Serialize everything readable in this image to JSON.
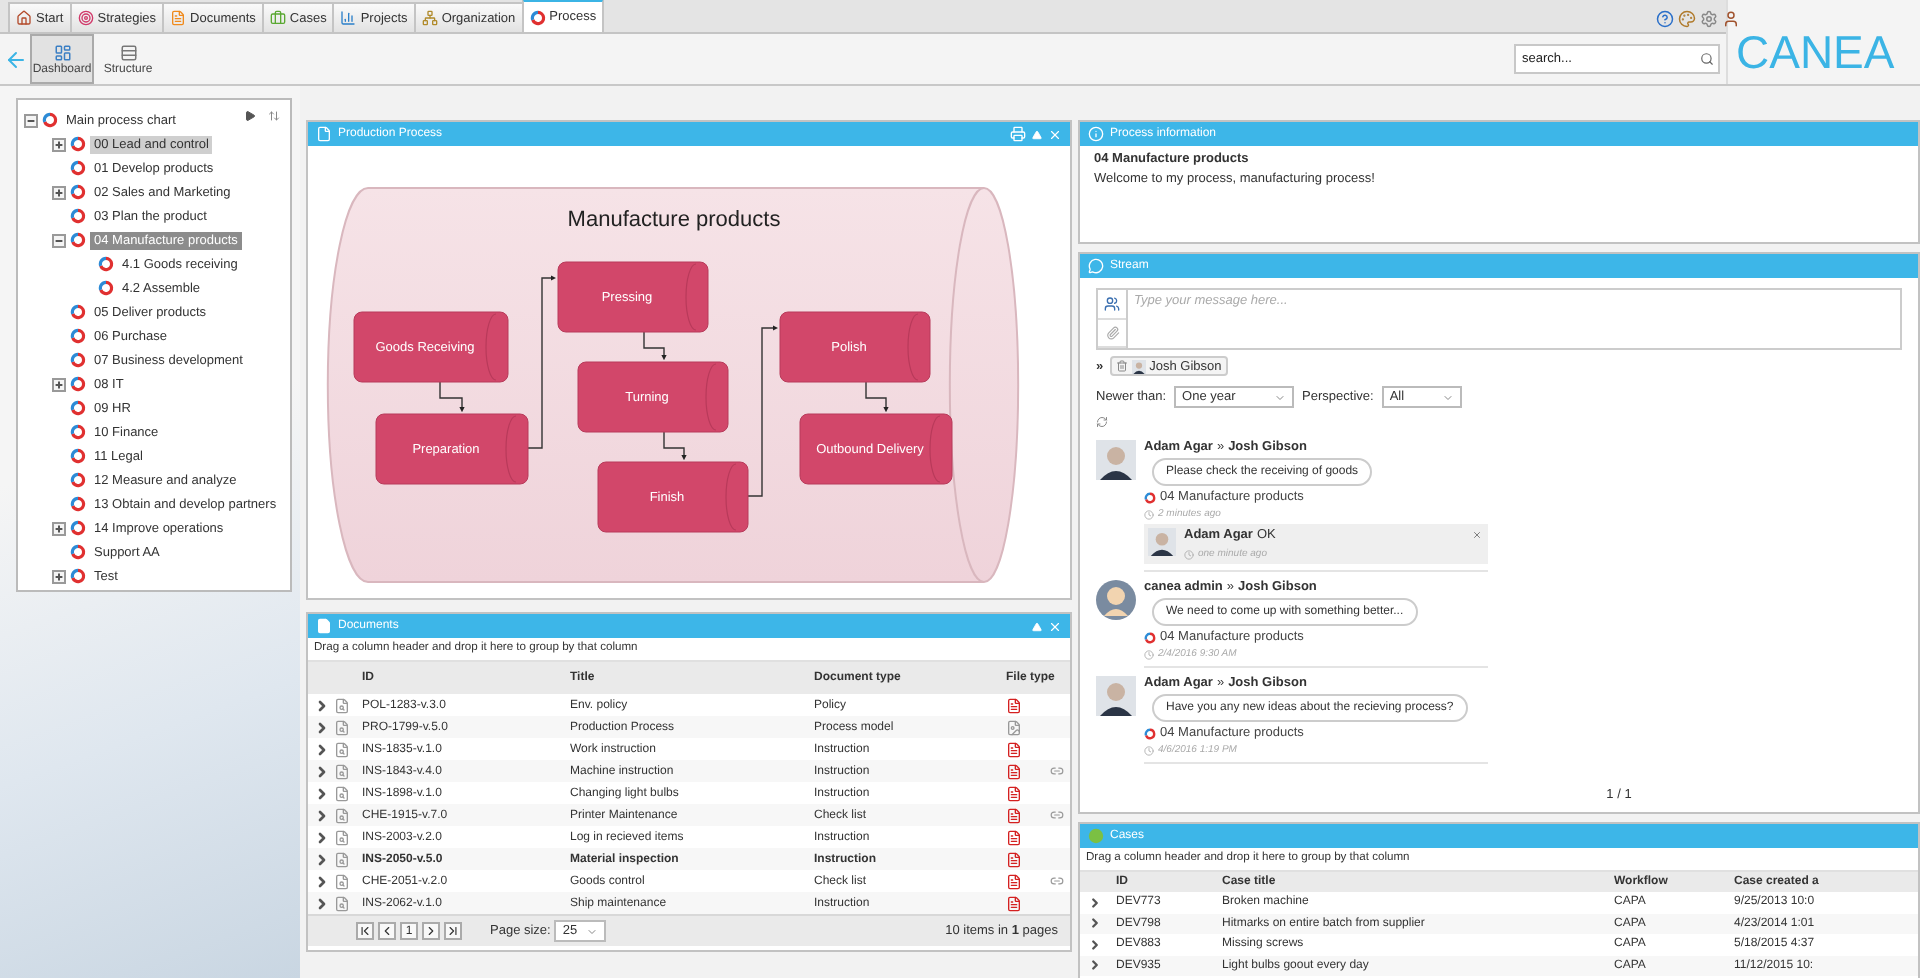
{
  "top_tabs": [
    {
      "label": "Start",
      "selected": false
    },
    {
      "label": "Strategies",
      "selected": false
    },
    {
      "label": "Documents",
      "selected": false
    },
    {
      "label": "Cases",
      "selected": false
    },
    {
      "label": "Projects",
      "selected": false
    },
    {
      "label": "Organization",
      "selected": false
    },
    {
      "label": "Process",
      "selected": true
    }
  ],
  "view_buttons": [
    {
      "label": "Dashboard",
      "selected": true
    },
    {
      "label": "Structure",
      "selected": false
    }
  ],
  "search": {
    "placeholder": "search..."
  },
  "logo": "CANEA",
  "tree": {
    "label": "Main process chart",
    "expandable": true,
    "expanded": true,
    "selected": false,
    "hovered": false,
    "children": [
      {
        "label": "00 Lead and control",
        "expandable": true,
        "expanded": false,
        "selected": false,
        "hovered": true
      },
      {
        "label": "01 Develop products",
        "expandable": false,
        "expanded": false,
        "selected": false,
        "hovered": false
      },
      {
        "label": "02 Sales and Marketing",
        "expandable": true,
        "expanded": false,
        "selected": false,
        "hovered": false
      },
      {
        "label": "03 Plan the product",
        "expandable": false,
        "expanded": false,
        "selected": false,
        "hovered": false
      },
      {
        "label": "04 Manufacture products",
        "expandable": true,
        "expanded": true,
        "selected": true,
        "hovered": false,
        "children": [
          {
            "label": "4.1 Goods receiving",
            "expandable": false,
            "expanded": false,
            "selected": false,
            "hovered": false
          },
          {
            "label": "4.2 Assemble",
            "expandable": false,
            "expanded": false,
            "selected": false,
            "hovered": false
          }
        ]
      },
      {
        "label": "05 Deliver products",
        "expandable": false,
        "expanded": false,
        "selected": false,
        "hovered": false
      },
      {
        "label": "06 Purchase",
        "expandable": false,
        "expanded": false,
        "selected": false,
        "hovered": false
      },
      {
        "label": "07 Business development",
        "expandable": false,
        "expanded": false,
        "selected": false,
        "hovered": false
      },
      {
        "label": "08 IT",
        "expandable": true,
        "expanded": false,
        "selected": false,
        "hovered": false
      },
      {
        "label": "09 HR",
        "expandable": false,
        "expanded": false,
        "selected": false,
        "hovered": false
      },
      {
        "label": "10 Finance",
        "expandable": false,
        "expanded": false,
        "selected": false,
        "hovered": false
      },
      {
        "label": "11 Legal",
        "expandable": false,
        "expanded": false,
        "selected": false,
        "hovered": false
      },
      {
        "label": "12 Measure and analyze",
        "expandable": false,
        "expanded": false,
        "selected": false,
        "hovered": false
      },
      {
        "label": "13 Obtain and develop partners",
        "expandable": false,
        "expanded": false,
        "selected": false,
        "hovered": false
      },
      {
        "label": "14 Improve operations",
        "expandable": true,
        "expanded": false,
        "selected": false,
        "hovered": false
      },
      {
        "label": "Support AA",
        "expandable": false,
        "expanded": false,
        "selected": false,
        "hovered": false
      },
      {
        "label": "Test",
        "expandable": true,
        "expanded": false,
        "selected": false,
        "hovered": false
      }
    ]
  },
  "process_panel": {
    "title": "Production Process",
    "diagram_title": "Manufacture products",
    "nodes": [
      {
        "label": "Goods Receiving"
      },
      {
        "label": "Preparation"
      },
      {
        "label": "Pressing"
      },
      {
        "label": "Turning"
      },
      {
        "label": "Finish"
      },
      {
        "label": "Polish"
      },
      {
        "label": "Outbound Delivery"
      }
    ]
  },
  "documents": {
    "title": "Documents",
    "group_hint": "Drag a column header and drop it here to group by that column",
    "columns": [
      "ID",
      "Title",
      "Document type",
      "File type"
    ],
    "rows": [
      {
        "id": "POL-1283-v.3.0",
        "title": "Env. policy",
        "type": "Policy",
        "kind": "pdf",
        "linked": false,
        "unread": false
      },
      {
        "id": "PRO-1799-v.5.0",
        "title": "Production Process",
        "type": "Process model",
        "kind": "model",
        "linked": false,
        "unread": false
      },
      {
        "id": "INS-1835-v.1.0",
        "title": "Work instruction",
        "type": "Instruction",
        "kind": "pdf",
        "linked": false,
        "unread": false
      },
      {
        "id": "INS-1843-v.4.0",
        "title": "Machine instruction",
        "type": "Instruction",
        "kind": "pdf",
        "linked": true,
        "unread": false
      },
      {
        "id": "INS-1898-v.1.0",
        "title": "Changing light bulbs",
        "type": "Instruction",
        "kind": "pdf",
        "linked": false,
        "unread": false
      },
      {
        "id": "CHE-1915-v.7.0",
        "title": "Printer Maintenance",
        "type": "Check list",
        "kind": "pdf",
        "linked": true,
        "unread": false
      },
      {
        "id": "INS-2003-v.2.0",
        "title": "Log in recieved items",
        "type": "Instruction",
        "kind": "pdf",
        "linked": false,
        "unread": false
      },
      {
        "id": "INS-2050-v.5.0",
        "title": "Material inspection",
        "type": "Instruction",
        "kind": "pdf",
        "linked": false,
        "unread": true
      },
      {
        "id": "CHE-2051-v.2.0",
        "title": "Goods control",
        "type": "Check list",
        "kind": "pdf",
        "linked": true,
        "unread": false
      },
      {
        "id": "INS-2062-v.1.0",
        "title": "Ship maintenance",
        "type": "Instruction",
        "kind": "pdf",
        "linked": false,
        "unread": false
      }
    ],
    "pager": {
      "page": "1",
      "page_size_label": "Page size:",
      "page_size": "25",
      "summary": "10 items in **1** pages"
    }
  },
  "process_info": {
    "title": "Process information",
    "heading": "04 Manufacture products",
    "text": "Welcome to my process, manufacturing process!"
  },
  "stream": {
    "title": "Stream",
    "placeholder": "Type your message here...",
    "recipient_row": {
      "to_mark": "»",
      "name": "Josh Gibson"
    },
    "filters": [
      {
        "label": "Newer than:",
        "value": "One year"
      },
      {
        "label": "Perspective:",
        "value": "All"
      }
    ],
    "posts": [
      {
        "author": "Adam Agar",
        "to_mark": "»",
        "recipient": "Josh Gibson",
        "avatar": {
          "kind": "photo"
        },
        "message": "Please check the receiving of goods",
        "process": "04 Manufacture products",
        "time": "2 minutes ago",
        "replies": [
          {
            "author": "Adam Agar",
            "text": "OK",
            "time": "one minute ago",
            "avatar": {
              "kind": "photo"
            }
          }
        ]
      },
      {
        "author": "canea admin",
        "to_mark": "»",
        "recipient": "Josh Gibson",
        "avatar": {
          "kind": "silhouette"
        },
        "message": "We need to come up with something better...",
        "process": "04 Manufacture products",
        "time": "2/4/2016 9:30 AM"
      },
      {
        "author": "Adam Agar",
        "to_mark": "»",
        "recipient": "Josh Gibson",
        "avatar": {
          "kind": "photo"
        },
        "message": "Have you any new ideas about the recieving process?",
        "process": "04 Manufacture products",
        "time": "4/6/2016 1:19 PM"
      }
    ],
    "pager": "1 / 1"
  },
  "cases": {
    "title": "Cases",
    "group_hint": "Drag a column header and drop it here to group by that column",
    "columns": [
      "ID",
      "Case title",
      "Workflow",
      "Case created a"
    ],
    "rows": [
      {
        "id": "DEV773",
        "title": "Broken machine",
        "workflow": "CAPA",
        "created": "9/25/2013 10:0"
      },
      {
        "id": "DEV798",
        "title": "Hitmarks on entire batch from supplier",
        "workflow": "CAPA",
        "created": "4/23/2014 1:01"
      },
      {
        "id": "DEV883",
        "title": "Missing screws",
        "workflow": "CAPA",
        "created": "5/18/2015 4:37"
      },
      {
        "id": "DEV935",
        "title": "Light bulbs goout every day",
        "workflow": "CAPA",
        "created": "11/12/2015 10:"
      }
    ]
  }
}
